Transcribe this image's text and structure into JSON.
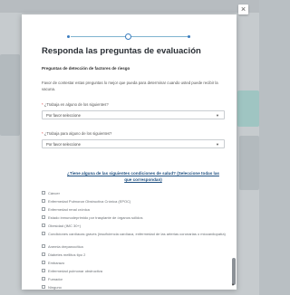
{
  "modal": {
    "close_label": "×",
    "title": "Responda las preguntas de evaluación",
    "section_heading": "Preguntas de detección de factores de riesgo",
    "intro": "Favor de contestar estas preguntas lo mejor que pueda para determinar cuando usted puede recibir la vacuna."
  },
  "fields": [
    {
      "label": "¿Trabaja en alguno de los siguientes?",
      "value": "Por favor seleccione"
    },
    {
      "label": "¿Trabaja para alguno de los siguientes?",
      "value": "Por favor seleccione"
    }
  ],
  "conditions": {
    "question": "¿Tiene alguna de las siguientes condiciones de salud? (Seleccione todas las que correspondan)",
    "options": [
      "Cáncer",
      "Enfermedad Pulmonar Obstructiva Crónica (EPOC)",
      "Enfermedad renal crónica",
      "Estado inmunodeprimido por trasplante de órganos sólidos",
      "Obesidad (IMC 30+)",
      "Condiciones cardíacas graves (insuficiencia cardíaca, enfermedad de las arterias coronarias o miocardiopatía)",
      "Anemia drepanocítica",
      "Diabetes mellitus tipo 2",
      "Embarazo",
      "Enfermedad pulmonar obstructiva",
      "Fumador",
      "Ninguno"
    ]
  },
  "colors": {
    "accent": "#3b7dbf",
    "question_text": "#1e4f80"
  }
}
